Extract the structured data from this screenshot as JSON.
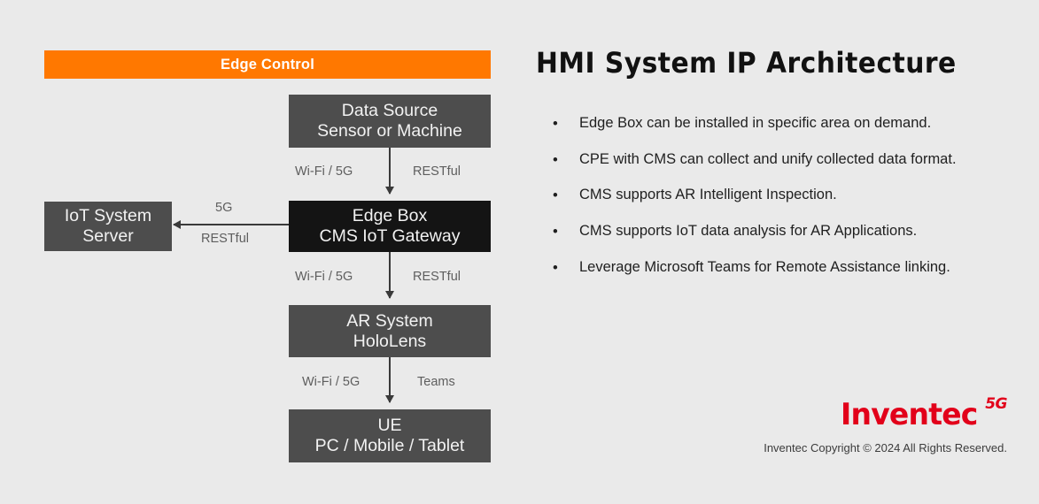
{
  "background_color": "#eaeaea",
  "diagram": {
    "header_bar": {
      "label": "Edge Control",
      "color": "#ff7800",
      "text_color": "#ffffff"
    },
    "nodes": {
      "data_source": {
        "line1": "Data Source",
        "line2": "Sensor or Machine",
        "color": "#4d4d4d"
      },
      "edge_box": {
        "line1": "Edge Box",
        "line2": "CMS IoT Gateway",
        "color": "#141414"
      },
      "iot_server": {
        "line1": "IoT System",
        "line2": "Server",
        "color": "#4d4d4d"
      },
      "ar_system": {
        "line1": "AR System",
        "line2": "HoloLens",
        "color": "#4d4d4d"
      },
      "ue": {
        "line1": "UE",
        "line2": "PC / Mobile / Tablet",
        "color": "#4d4d4d"
      }
    },
    "connectors": {
      "data_source_to_edge_box": {
        "left_label": "Wi-Fi / 5G",
        "right_label": "RESTful"
      },
      "edge_box_to_iot_server": {
        "top_label": "5G",
        "bottom_label": "RESTful"
      },
      "edge_box_to_ar_system": {
        "left_label": "Wi-Fi / 5G",
        "right_label": "RESTful"
      },
      "ar_system_to_ue": {
        "left_label": "Wi-Fi / 5G",
        "right_label": "Teams"
      }
    }
  },
  "content": {
    "title": "HMI System IP Architecture",
    "bullet_marker": "•",
    "bullets": [
      "Edge Box can be installed in specific area on demand.",
      "CPE with CMS can collect and unify collected data format.",
      "CMS supports AR Intelligent Inspection.",
      "CMS supports IoT data analysis for AR Applications.",
      "Leverage Microsoft Teams for Remote Assistance linking."
    ]
  },
  "footer": {
    "logo_word": "Inventec",
    "logo_badge": "5G",
    "logo_color": "#e2001a",
    "copyright": "Inventec Copyright © 2024  All Rights Reserved."
  }
}
